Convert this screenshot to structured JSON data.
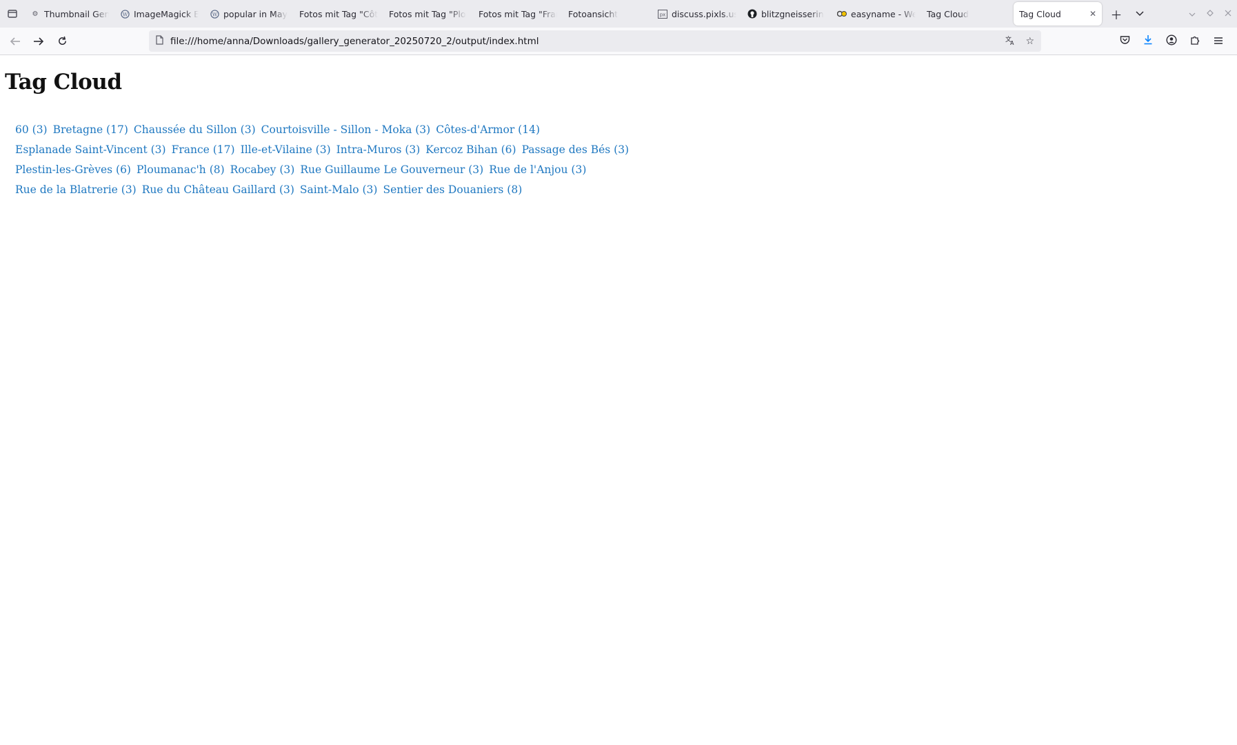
{
  "tabs": [
    {
      "title": "Thumbnail Gen",
      "icon": "gear-icon"
    },
    {
      "title": "ImageMagick E",
      "icon": "wordpress-icon"
    },
    {
      "title": "popular in May",
      "icon": "wordpress-icon"
    },
    {
      "title": "Fotos mit Tag \"Côt",
      "icon": ""
    },
    {
      "title": "Fotos mit Tag \"Plo",
      "icon": ""
    },
    {
      "title": "Fotos mit Tag \"Fran",
      "icon": ""
    },
    {
      "title": "Fotoansicht",
      "icon": ""
    },
    {
      "title": "discuss.pixls.us",
      "icon": "pixls-icon"
    },
    {
      "title": "blitzgneisserin",
      "icon": "github-icon"
    },
    {
      "title": "easyname - We",
      "icon": "easyname-icon"
    },
    {
      "title": "Tag Cloud",
      "icon": ""
    }
  ],
  "active_tab": {
    "title": "Tag Cloud"
  },
  "address_bar": {
    "url": "file:///home/anna/Downloads/gallery_generator_20250720_2/output/index.html"
  },
  "page": {
    "heading": "Tag Cloud",
    "tag_lines": [
      [
        "60 (3)",
        "Bretagne (17)",
        "Chaussée du Sillon (3)",
        "Courtoisville - Sillon - Moka (3)",
        "Côtes-d'Armor (14)"
      ],
      [
        "Esplanade Saint-Vincent (3)",
        "France (17)",
        "Ille-et-Vilaine (3)",
        "Intra-Muros (3)",
        "Kercoz Bihan (6)",
        "Passage des Bés (3)"
      ],
      [
        "Plestin-les-Grèves (6)",
        "Ploumanac'h (8)",
        "Rocabey (3)",
        "Rue Guillaume Le Gouverneur (3)",
        "Rue de l'Anjou (3)"
      ],
      [
        "Rue de la Blatrerie (3)",
        "Rue du Château Gaillard (3)",
        "Saint-Malo (3)",
        "Sentier des Douaniers (8)"
      ]
    ]
  },
  "colors": {
    "link": "#1f78c1",
    "download_accent": "#0a84ff"
  }
}
